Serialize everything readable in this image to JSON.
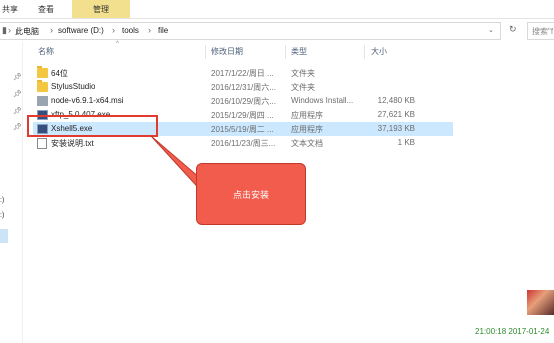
{
  "ribbon": {
    "tabs": [
      {
        "label": "共享"
      },
      {
        "label": "查看"
      },
      {
        "label": "管理"
      }
    ]
  },
  "address": {
    "path": [
      "此电脑",
      "software (D:)",
      "tools",
      "file"
    ],
    "chevron": "›",
    "search_placeholder": "搜索\"f"
  },
  "nav": {
    "labels": [
      ":)",
      ":)"
    ]
  },
  "columns": {
    "name": "名称",
    "date": "修改日期",
    "type": "类型",
    "size": "大小"
  },
  "files": [
    {
      "name": "64位",
      "date": "2017/1/22/周日 ...",
      "type": "文件夹",
      "size": "",
      "icon": "folder-icon"
    },
    {
      "name": "StylusStudio",
      "date": "2016/12/31/周六...",
      "type": "文件夹",
      "size": "",
      "icon": "folder-icon"
    },
    {
      "name": "node-v6.9.1-x64.msi",
      "date": "2016/10/29/周六...",
      "type": "Windows Install...",
      "size": "12,480 KB",
      "icon": "msi-icon"
    },
    {
      "name": "xftp_5.0.407.exe",
      "date": "2015/1/29/周四 ...",
      "type": "应用程序",
      "size": "27,621 KB",
      "icon": "exe-icon"
    },
    {
      "name": "Xshell5.exe",
      "date": "2015/5/19/周二 ...",
      "type": "应用程序",
      "size": "37,193 KB",
      "icon": "exe-icon"
    },
    {
      "name": "安装说明.txt",
      "date": "2016/11/23/周三...",
      "type": "文本文档",
      "size": "1 KB",
      "icon": "text-file-icon"
    }
  ],
  "annotation": {
    "text": "点击安装",
    "color": "#f25c4c"
  },
  "clock": {
    "text": "21:00:18 2017-01-24"
  }
}
